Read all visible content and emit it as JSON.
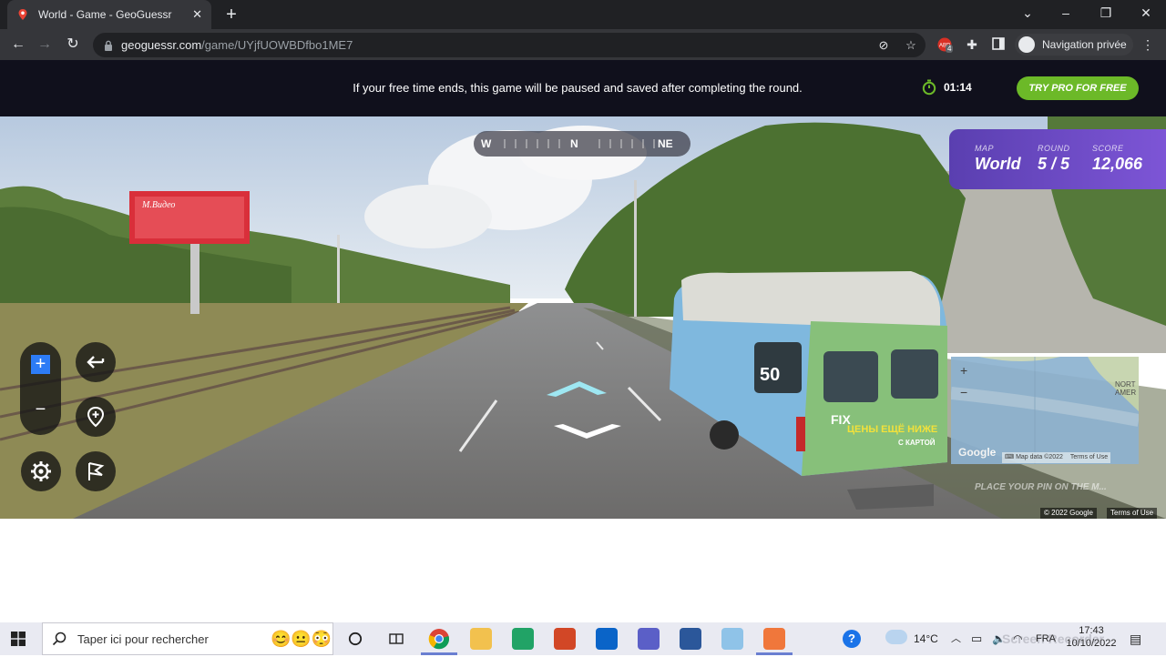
{
  "browser": {
    "tab_title": "World - Game - GeoGuessr",
    "url_host": "geoguessr.com",
    "url_path": "/game/UYjfUOWBDfbo1ME7",
    "profile_label": "Navigation privée",
    "ext_badge": "4"
  },
  "promo": {
    "message": "If your free time ends, this game will be paused and saved after completing the round.",
    "timer": "01:14",
    "cta": "TRY PRO FOR FREE"
  },
  "compass": {
    "left": "W",
    "center": "N",
    "right": "NE"
  },
  "hud": {
    "map_label": "MAP",
    "map_value": "World",
    "round_label": "ROUND",
    "round_value": "5 / 5",
    "score_label": "SCORE",
    "score_value": "12,066"
  },
  "minimap": {
    "region_label": "NORT AMER",
    "map_data": "Map data ©2022",
    "terms": "Terms of Use",
    "google": "Google",
    "place_pin": "PLACE YOUR PIN ON THE M..."
  },
  "streetview": {
    "copyright": "© 2022 Google",
    "terms": "Terms of Use",
    "billboard_text": "М.Видео",
    "van_route": "50",
    "van_brand": "FIX",
    "van_slogan": "ЦЕНЫ ЕЩЁ НИЖЕ",
    "van_slogan2": "С КАРТОЙ"
  },
  "taskbar": {
    "search_placeholder": "Taper ici pour rechercher",
    "weather": "14°C",
    "language": "FRA",
    "time": "17:43",
    "date": "10/10/2022",
    "watermark": "Screen Recorder"
  },
  "colors": {
    "accent_green": "#6cb928",
    "hud_purple": "#6a48c4",
    "promo_bg": "#10101c"
  }
}
